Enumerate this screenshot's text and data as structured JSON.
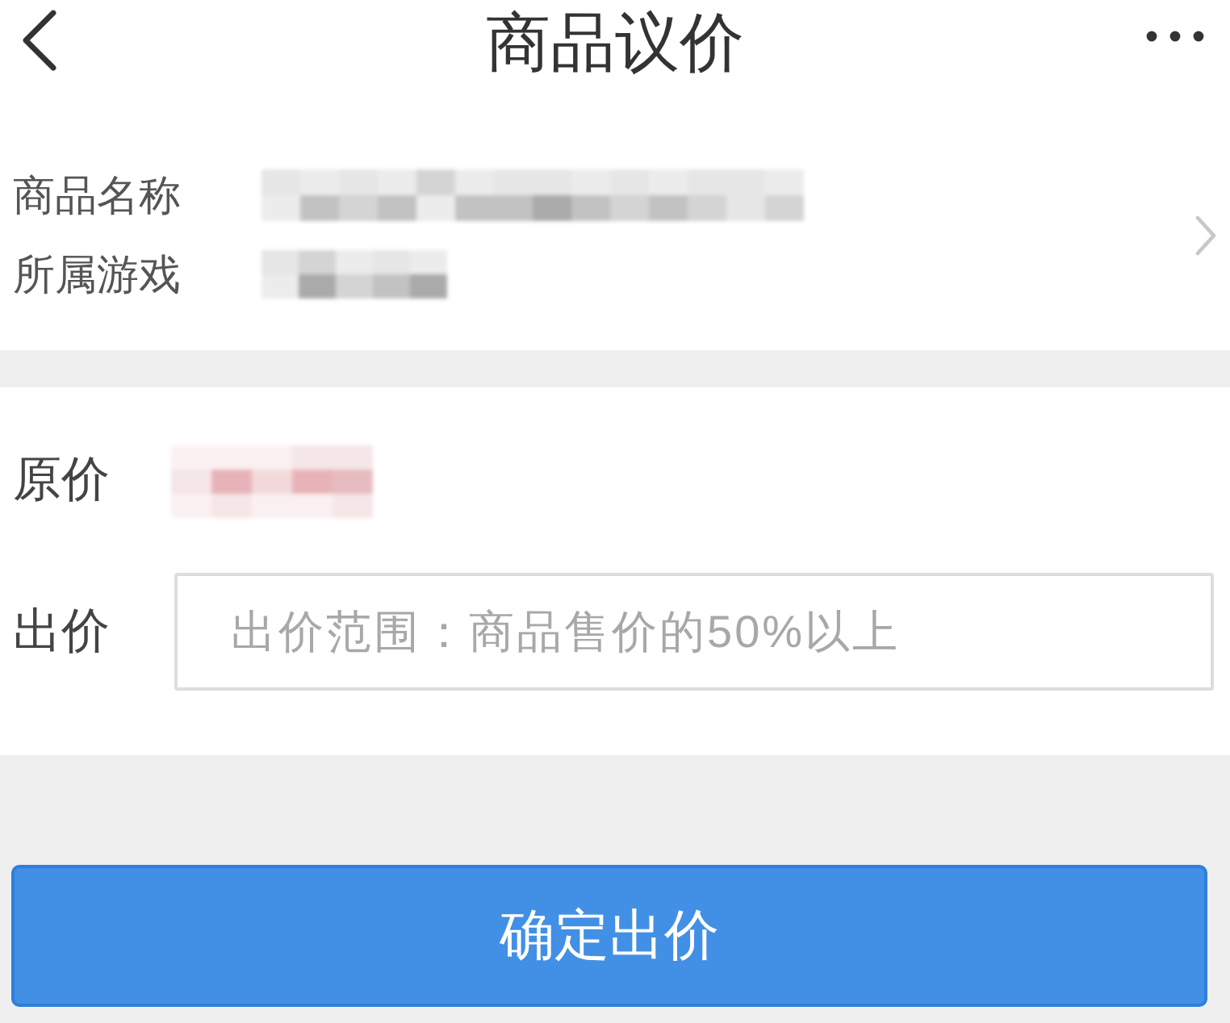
{
  "header": {
    "title": "商品议价"
  },
  "product": {
    "fields": [
      {
        "label": "商品名称",
        "masked": true
      },
      {
        "label": "所属游戏",
        "masked": true
      }
    ]
  },
  "offer": {
    "original_price": {
      "label": "原价",
      "masked": true
    },
    "bid": {
      "label": "出价",
      "placeholder": "出价范围：商品售价的50%以上"
    }
  },
  "submit_button": {
    "label": "确定出价"
  }
}
